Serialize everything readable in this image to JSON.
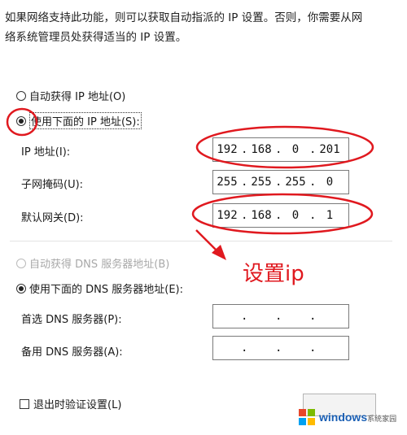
{
  "intro": {
    "line1": "如果网络支持此功能，则可以获取自动指派的 IP 设置。否则，你需要从网",
    "line2": "络系统管理员处获得适当的 IP 设置。"
  },
  "ip_mode": {
    "auto_label": "自动获得 IP 地址(O)",
    "manual_label": "使用下面的 IP 地址(S):",
    "selected": "manual"
  },
  "ip_fields": [
    {
      "label": "IP 地址(I):",
      "octets": [
        "192",
        "168",
        "0",
        "201"
      ]
    },
    {
      "label": "子网掩码(U):",
      "octets": [
        "255",
        "255",
        "255",
        "0"
      ]
    },
    {
      "label": "默认网关(D):",
      "octets": [
        "192",
        "168",
        "0",
        "1"
      ]
    }
  ],
  "dns_mode": {
    "auto_label": "自动获得 DNS 服务器地址(B)",
    "auto_disabled": true,
    "manual_label": "使用下面的 DNS 服务器地址(E):",
    "selected": "manual"
  },
  "dns_fields": [
    {
      "label": "首选 DNS 服务器(P):",
      "octets": [
        "",
        "",
        "",
        ""
      ]
    },
    {
      "label": "备用 DNS 服务器(A):",
      "octets": [
        "",
        "",
        "",
        ""
      ]
    }
  ],
  "validate_on_exit": {
    "label": "退出时验证设置(L)",
    "checked": false
  },
  "annotation": {
    "text": "设置ip",
    "color": "#e0191f"
  },
  "watermark": {
    "brand": "windows",
    "sub": "系统家园"
  },
  "icons": {
    "radio_selected": "radio-selected-icon",
    "arrow": "red-arrow-icon"
  }
}
